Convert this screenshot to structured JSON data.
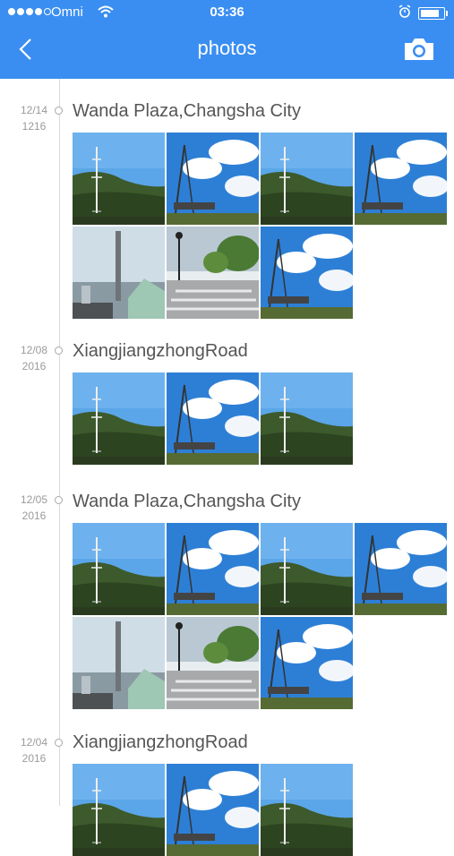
{
  "status_bar": {
    "carrier": "Omni",
    "time": "03:36"
  },
  "nav": {
    "title": "photos",
    "back_icon": "chevron-left-icon",
    "camera_icon": "camera-icon"
  },
  "colors": {
    "accent": "#3a8ef1",
    "timeline": "#d9d9d9",
    "date_text": "#9a9a9a",
    "place_text": "#555555"
  },
  "groups": [
    {
      "date_line1": "12/14",
      "date_line2": "1216",
      "place": "Wanda Plaza,Changsha City",
      "photos": [
        "hill-tower",
        "sky-tower",
        "hill-tower",
        "sky-tower",
        "city-chimney",
        "street-plaza",
        "sky-tower"
      ]
    },
    {
      "date_line1": "12/08",
      "date_line2": "2016",
      "place": "XiangjiangzhongRoad",
      "photos": [
        "hill-tower",
        "sky-tower",
        "hill-tower"
      ]
    },
    {
      "date_line1": "12/05",
      "date_line2": "2016",
      "place": "Wanda Plaza,Changsha City",
      "photos": [
        "hill-tower",
        "sky-tower",
        "hill-tower",
        "sky-tower",
        "city-chimney",
        "street-plaza",
        "sky-tower"
      ]
    },
    {
      "date_line1": "12/04",
      "date_line2": "2016",
      "place": "XiangjiangzhongRoad",
      "photos": [
        "hill-tower",
        "sky-tower",
        "hill-tower"
      ]
    }
  ]
}
